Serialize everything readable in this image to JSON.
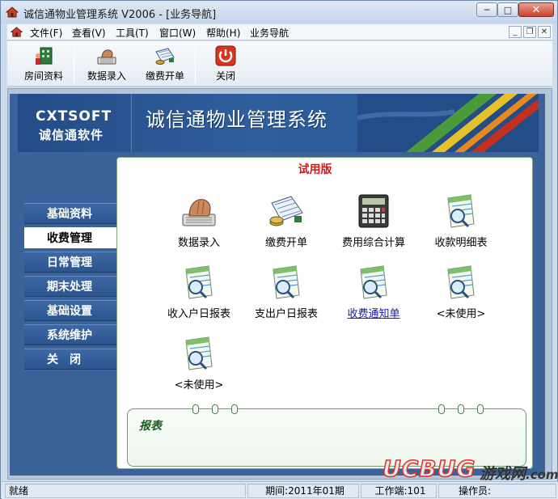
{
  "window": {
    "title": "诚信通物业管理系统 V2006 - [业务导航]",
    "minimize": "─",
    "maximize": "□",
    "close": "✕"
  },
  "menu": {
    "items": [
      "文件(F)",
      "查看(V)",
      "工具(T)",
      "窗口(W)",
      "帮助(H)",
      "业务导航"
    ],
    "mdi": [
      "_",
      "❐",
      "✕"
    ]
  },
  "toolbar": {
    "buttons": [
      {
        "label": "房间资料",
        "icon": "room-icon"
      },
      {
        "label": "数据录入",
        "icon": "keyboard-hand-icon"
      },
      {
        "label": "缴费开单",
        "icon": "billing-icon"
      },
      {
        "label": "关闭",
        "icon": "power-icon"
      }
    ]
  },
  "banner": {
    "logo_en": "CXTSOFT",
    "logo_cn": "诚信通软件",
    "title": "诚信通物业管理系统"
  },
  "nav": {
    "items": [
      "基础资料",
      "收费管理",
      "日常管理",
      "期末处理",
      "基础设置",
      "系统维护",
      "关　闭"
    ],
    "active": 1
  },
  "panel": {
    "trial": "试用版",
    "modules": [
      {
        "label": "数据录入",
        "icon": "keyboard-hand-icon",
        "link": false
      },
      {
        "label": "缴费开单",
        "icon": "billing-icon",
        "link": false
      },
      {
        "label": "费用综合计算",
        "icon": "calculator-icon",
        "link": false
      },
      {
        "label": "收款明细表",
        "icon": "report-magnifier-icon",
        "link": false
      },
      {
        "label": "收入户日报表",
        "icon": "report-magnifier-icon",
        "link": false
      },
      {
        "label": "支出户日报表",
        "icon": "report-magnifier-icon",
        "link": false
      },
      {
        "label": "收费通知单",
        "icon": "report-magnifier-icon",
        "link": true
      },
      {
        "label": "<未使用>",
        "icon": "report-magnifier-icon",
        "link": false
      },
      {
        "label": "<未使用>",
        "icon": "report-magnifier-icon",
        "link": false
      }
    ],
    "report_title": "报表"
  },
  "status": {
    "ready": "就绪",
    "period": "期间:2011年01期",
    "workstation": "工作端:101",
    "operator": "操作员:"
  },
  "watermark": {
    "text": "UCBUG",
    "sub": "游戏网",
    "suffix": ".com"
  },
  "colors": {
    "accent": "#3c6399",
    "trial": "#d11b1b",
    "report": "#1b5c24"
  }
}
